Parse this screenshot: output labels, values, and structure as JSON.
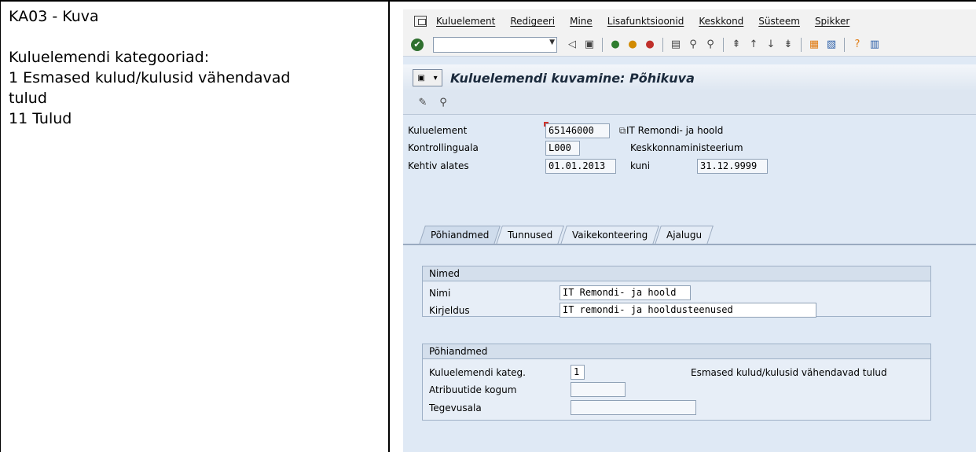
{
  "doc": {
    "title": "KA03 - Kuva",
    "categories_heading": "Kuluelemendi kategooriad:",
    "line1": "1 Esmased kulud/kulusid vähendavad",
    "line2": "tulud",
    "line3": "11 Tulud"
  },
  "menubar": {
    "items": [
      "Kuluelement",
      "Redigeeri",
      "Mine",
      "Lisafunktsioonid",
      "Keskkond",
      "Süsteem",
      "Spikker"
    ]
  },
  "screen": {
    "title": "Kuluelemendi kuvamine: Põhikuva"
  },
  "header_fields": {
    "cost_element_label": "Kuluelement",
    "cost_element_value": "65146000",
    "cost_element_text": "IT Remondi- ja hoold",
    "controlling_area_label": "Kontrollinguala",
    "controlling_area_value": "L000",
    "controlling_area_text": "Keskkonnaministeerium",
    "valid_from_label": "Kehtiv alates",
    "valid_from_value": "01.01.2013",
    "to_label": "kuni",
    "to_value": "31.12.9999"
  },
  "tabs": [
    "Põhiandmed",
    "Tunnused",
    "Vaikekonteering",
    "Ajalugu"
  ],
  "names_group": {
    "title": "Nimed",
    "name_label": "Nimi",
    "name_value": "IT Remondi- ja hoold",
    "desc_label": "Kirjeldus",
    "desc_value": "IT remondi- ja hooldusteenused"
  },
  "basic_group": {
    "title": "Põhiandmed",
    "category_label": "Kuluelemendi kateg.",
    "category_value": "1",
    "category_text": "Esmased kulud/kulusid vähendavad tulud",
    "attribute_label": "Atribuutide kogum",
    "attribute_value": "",
    "function_label": "Tegevusala",
    "function_value": ""
  }
}
